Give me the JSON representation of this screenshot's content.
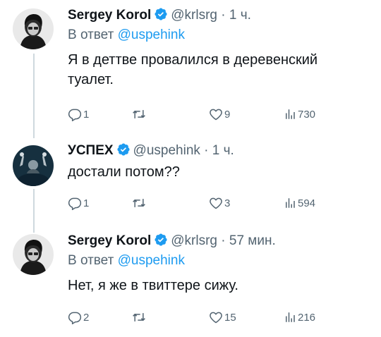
{
  "tweets": [
    {
      "name": "Sergey Korol",
      "handle": "@krlsrg",
      "sep": "·",
      "time": "1 ч.",
      "reply_prefix": "В ответ",
      "reply_mention": "@uspehink",
      "text": "Я в деттве провалился в деревенский туалет.",
      "replies": "1",
      "retweets": "",
      "likes": "9",
      "views": "730"
    },
    {
      "name": "УСПЕХ",
      "handle": "@uspehink",
      "sep": "·",
      "time": "1 ч.",
      "text": "достали потом??",
      "replies": "1",
      "retweets": "",
      "likes": "3",
      "views": "594"
    },
    {
      "name": "Sergey Korol",
      "handle": "@krlsrg",
      "sep": "·",
      "time": "57 мин.",
      "reply_prefix": "В ответ",
      "reply_mention": "@uspehink",
      "text": "Нет, я же в твиттере сижу.",
      "replies": "2",
      "retweets": "",
      "likes": "15",
      "views": "216"
    }
  ],
  "icons": {
    "verified": "verified-badge-icon",
    "reply": "reply-icon",
    "retweet": "retweet-icon",
    "like": "heart-icon",
    "views": "views-chart-icon"
  },
  "colors": {
    "text": "#0f1419",
    "secondary": "#536471",
    "link": "#1d9bf0",
    "verified": "#1d9bf0",
    "thread_line": "#cfd9de"
  }
}
